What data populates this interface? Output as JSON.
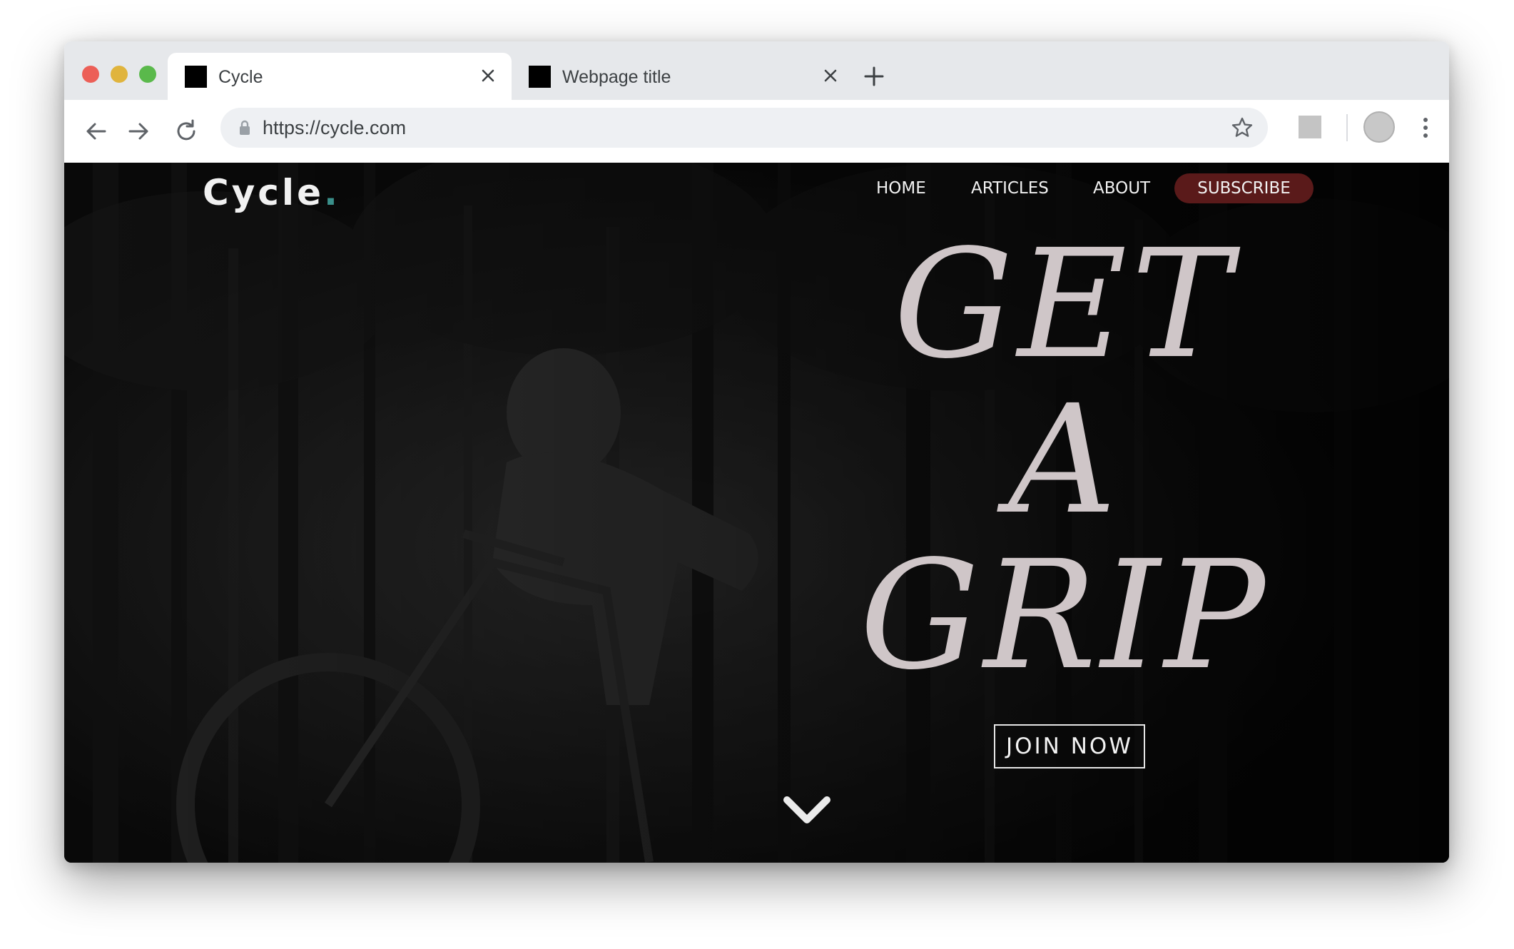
{
  "browser": {
    "tabs": [
      {
        "title": "Cycle",
        "active": true
      },
      {
        "title": "Webpage title",
        "active": false
      }
    ],
    "url": "https://cycle.com"
  },
  "site": {
    "logo_text": "Cycle",
    "logo_dot": ".",
    "logo_dot_color": "#3a8f8a",
    "nav": [
      {
        "label": "HOME"
      },
      {
        "label": "ARTICLES"
      },
      {
        "label": "ABOUT"
      },
      {
        "label": "SUBSCRIBE",
        "highlight_color": "#5a1a1a"
      }
    ],
    "headline": [
      "GET",
      "A",
      "GRIP"
    ],
    "cta_label": "JOIN NOW",
    "scroll_icon": "chevron-down-icon"
  }
}
